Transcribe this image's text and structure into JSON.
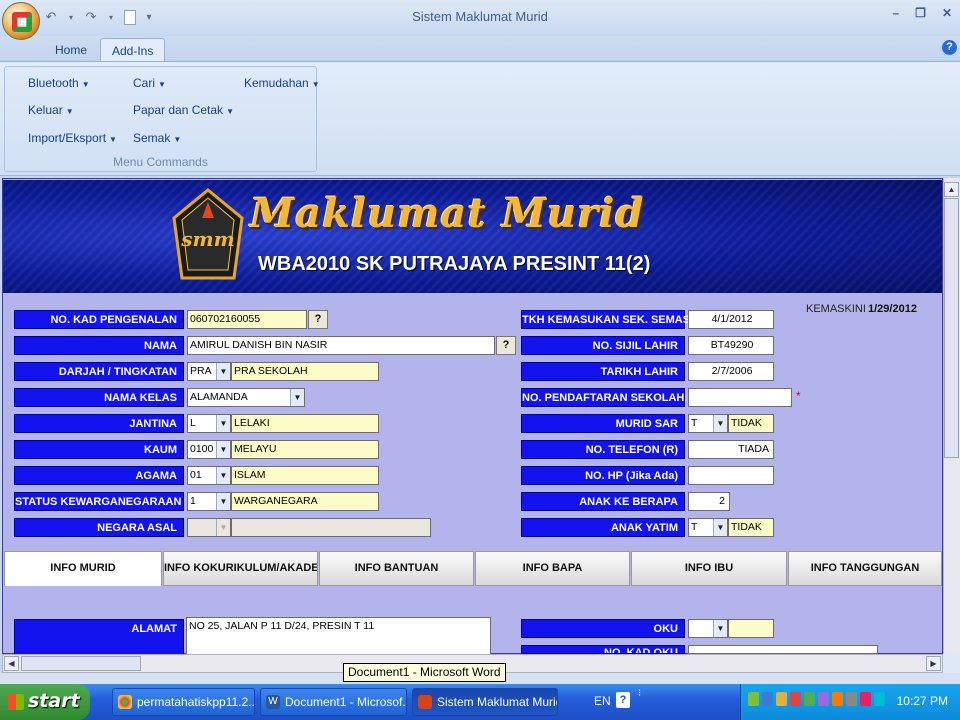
{
  "window": {
    "title": "Sistem Maklumat Murid"
  },
  "ribbon": {
    "tabs": [
      "Home",
      "Add-Ins"
    ],
    "menus": [
      "Bluetooth",
      "Keluar",
      "Import/Eksport",
      "Cari",
      "Papar dan Cetak",
      "Semak",
      "Kemudahan"
    ],
    "group_caption": "Menu Commands"
  },
  "banner": {
    "title": "Maklumat Murid",
    "school": "WBA2010 SK PUTRAJAYA PRESINT 11(2)",
    "logo_text": "smm"
  },
  "kemaskini": {
    "label": "KEMASKINI",
    "date": "1/29/2012"
  },
  "form_left": [
    {
      "label": "NO. KAD PENGENALAN",
      "value": "060702160055"
    },
    {
      "label": "NAMA",
      "value": "AMIRUL DANISH BIN NASIR"
    },
    {
      "label": "DARJAH / TINGKATAN",
      "code": "PRA",
      "value": "PRA SEKOLAH"
    },
    {
      "label": "NAMA KELAS",
      "value": "ALAMANDA"
    },
    {
      "label": "JANTINA",
      "code": "L",
      "value": "LELAKI"
    },
    {
      "label": "KAUM",
      "code": "0100",
      "value": "MELAYU"
    },
    {
      "label": "AGAMA",
      "code": "01",
      "value": "ISLAM"
    },
    {
      "label": "STATUS KEWARGANEGARAAN",
      "code": "1",
      "value": "WARGANEGARA"
    },
    {
      "label": "NEGARA ASAL",
      "code": "",
      "value": ""
    }
  ],
  "form_right": [
    {
      "label": "TKH KEMASUKAN SEK. SEMASA",
      "value": "4/1/2012"
    },
    {
      "label": "NO. SIJIL LAHIR",
      "value": "BT49290"
    },
    {
      "label": "TARIKH LAHIR",
      "value": "2/7/2006"
    },
    {
      "label": "NO. PENDAFTARAN SEKOLAH",
      "value": "",
      "mark": "*"
    },
    {
      "label": "MURID SAR",
      "code": "T",
      "value": "TIDAK"
    },
    {
      "label": "NO. TELEFON (R)",
      "value": "TIADA"
    },
    {
      "label": "NO. HP (Jika Ada)",
      "value": ""
    },
    {
      "label": "ANAK KE BERAPA",
      "value": "2"
    },
    {
      "label": "ANAK YATIM",
      "code": "T",
      "value": "TIDAK"
    }
  ],
  "form_tabs": [
    "INFO MURID",
    "INFO KOKURIKULUM/AKADEMIK",
    "INFO BANTUAN",
    "INFO BAPA",
    "INFO IBU",
    "INFO TANGGUNGAN"
  ],
  "lower": {
    "alamat_label": "ALAMAT",
    "alamat_value": "NO 25, JALAN P 11 D/24, PRESIN T 11",
    "oku_label": "OKU",
    "kad_oku_label": "NO. KAD OKU"
  },
  "tooltip": "Document1 - Microsoft Word",
  "taskbar": {
    "start": "start",
    "tasks": [
      "permatahatiskpp11.2...",
      "Document1 - Microsof...",
      "Sistem Maklumat Murid"
    ],
    "lang": "EN",
    "clock": "10:27 PM"
  }
}
